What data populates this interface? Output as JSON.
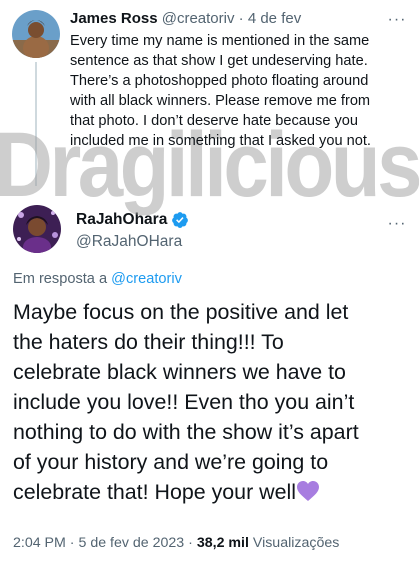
{
  "tweet1": {
    "name": "James Ross",
    "handle": "@creatoriv",
    "separator": "·",
    "date": "4 de fev",
    "text_lines": [
      "Every time my name is mentioned in the same",
      "sentence as that show I get undeserving hate.",
      "There’s a photoshopped photo floating around",
      "with all black winners. Please remove me from",
      "that photo. I don’t deserve hate because you",
      "included me in something that I asked you not."
    ],
    "more_icon": "more-horizontal-icon"
  },
  "watermark": {
    "text": "Dragilicious",
    "color": "#9e9e9e"
  },
  "tweet2": {
    "name": "RaJahOhara",
    "verified_icon": "verified-badge-icon",
    "verified_color": "#1d9bf0",
    "handle": "@RaJahOHara",
    "more_icon": "more-horizontal-icon",
    "reply_prefix": "Em resposta a",
    "reply_handle": "@creatoriv",
    "text_lines": [
      "Maybe focus on the positive and let",
      "the haters do their thing!!! To",
      "celebrate black winners we have to",
      "include you love!! Even tho you ain’t",
      "nothing to do with the show it’s apart",
      "of your history and we’re going to",
      "celebrate that! Hope your well"
    ],
    "emoji_icon": "purple-heart-icon",
    "emoji_color": "#a77de0",
    "time": "2:04 PM",
    "separator": "·",
    "date": "5 de fev de 2023",
    "separator2": "·",
    "views_count": "38,2 mil",
    "views_label": "Visualizações"
  },
  "colors": {
    "text": "#0f1419",
    "muted": "#536471",
    "link": "#1d9bf0",
    "thread_line": "#cfd9de"
  }
}
